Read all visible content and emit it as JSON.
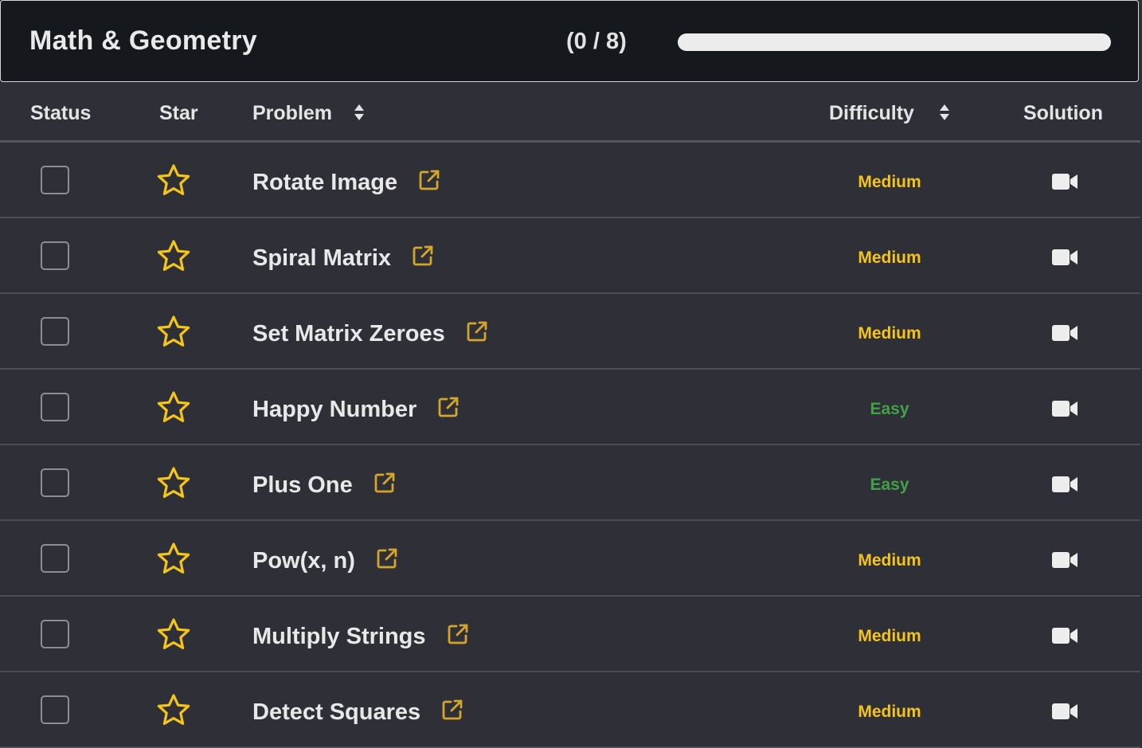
{
  "header": {
    "title": "Math & Geometry",
    "count": "(0 / 8)",
    "progress_fraction": 0
  },
  "columns": {
    "status": "Status",
    "star": "Star",
    "problem": "Problem",
    "difficulty": "Difficulty",
    "solution": "Solution"
  },
  "rows": [
    {
      "problem": "Rotate Image",
      "difficulty": "Medium"
    },
    {
      "problem": "Spiral Matrix",
      "difficulty": "Medium"
    },
    {
      "problem": "Set Matrix Zeroes",
      "difficulty": "Medium"
    },
    {
      "problem": "Happy Number",
      "difficulty": "Easy"
    },
    {
      "problem": "Plus One",
      "difficulty": "Easy"
    },
    {
      "problem": "Pow(x, n)",
      "difficulty": "Medium"
    },
    {
      "problem": "Multiply Strings",
      "difficulty": "Medium"
    },
    {
      "problem": "Detect Squares",
      "difficulty": "Medium"
    }
  ],
  "colors": {
    "medium": "#f5c418",
    "easy": "#43a047",
    "star": "#f5c518",
    "link": "#d4a52a"
  },
  "icons": {
    "status": "checkbox-empty",
    "star": "star-outline-icon",
    "link": "external-link-icon",
    "solution": "video-camera-icon",
    "sort": "sort-icon"
  }
}
